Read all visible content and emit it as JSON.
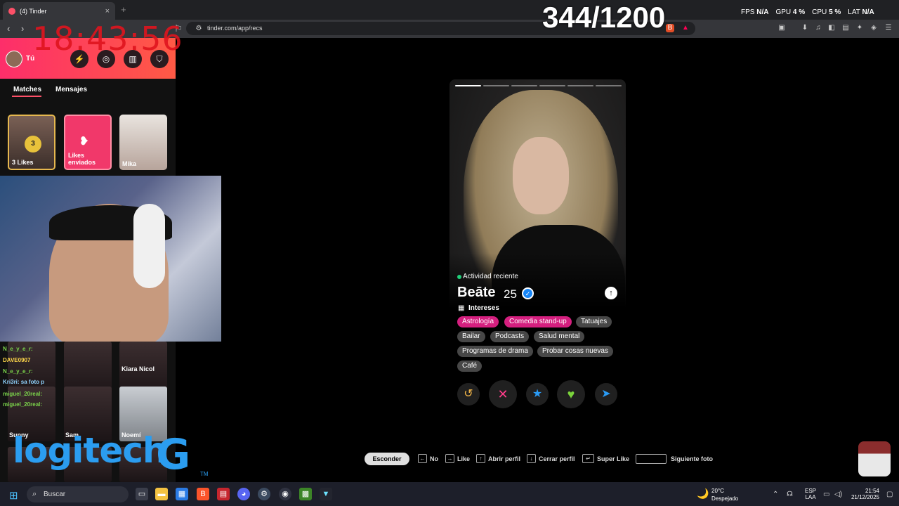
{
  "browser": {
    "tab_title": "(4) Tinder",
    "url": "tinder.com/app/recs",
    "new_tab_glyph": "+"
  },
  "overlay": {
    "clock": "18:43:56",
    "counter": "344/1200",
    "stats": [
      {
        "label": "FPS",
        "value": "N/A"
      },
      {
        "label": "GPU",
        "value": "4 %"
      },
      {
        "label": "CPU",
        "value": "5 %"
      },
      {
        "label": "LAT",
        "value": "N/A"
      }
    ],
    "sponsor_logo": "logitech",
    "sponsor_tm": "TM"
  },
  "sidebar": {
    "user_label": "Tú",
    "tabs": [
      "Matches",
      "Mensajes"
    ],
    "likes_count": "3",
    "likes_label": "3 Likes",
    "sent_label": "Likes enviados",
    "match_name": "Mika",
    "messages": [
      {
        "name": "Kiara Nicol"
      },
      {
        "name": "Sunny"
      },
      {
        "name": "Sam"
      },
      {
        "name": "Noemí"
      }
    ],
    "chat": [
      {
        "user": "N_e_y_e_r",
        "text": ":"
      },
      {
        "user": "DAVE0907",
        "text": ""
      },
      {
        "user": "N_e_y_e_r",
        "text": ":"
      },
      {
        "user": "Kri3ri",
        "text": ": sa foto p"
      },
      {
        "user": "miguel_20real",
        "text": ":"
      },
      {
        "user": "miguel_20real",
        "text": ":"
      }
    ]
  },
  "profile": {
    "photo_count": 6,
    "active_photo": 1,
    "activity": "Actividad reciente",
    "name": "Beāte",
    "age": "25",
    "interests_label": "Intereses",
    "interests": [
      {
        "label": "Astrología",
        "shared": true
      },
      {
        "label": "Comedia stand-up",
        "shared": true
      },
      {
        "label": "Tatuajes",
        "shared": false
      },
      {
        "label": "Bailar",
        "shared": false
      },
      {
        "label": "Podcasts",
        "shared": false
      },
      {
        "label": "Salud mental",
        "shared": false
      },
      {
        "label": "Programas de drama",
        "shared": false
      },
      {
        "label": "Probar cosas nuevas",
        "shared": false
      },
      {
        "label": "Café",
        "shared": false
      }
    ],
    "actions": [
      {
        "name": "rewind-button",
        "glyph": "↺",
        "color": "#f5b748"
      },
      {
        "name": "nope-button",
        "glyph": "✕",
        "color": "#ff3d8b"
      },
      {
        "name": "super-like-button",
        "glyph": "★",
        "color": "#2a9bf5"
      },
      {
        "name": "like-button",
        "glyph": "♥",
        "color": "#7ad33b"
      },
      {
        "name": "boost-button",
        "glyph": "➤",
        "color": "#2a9bf5"
      }
    ]
  },
  "shortcuts": {
    "hide_label": "Esconder",
    "items": [
      {
        "key": "←",
        "label": "No"
      },
      {
        "key": "→",
        "label": "Like"
      },
      {
        "key": "↑",
        "label": "Abrir perfil"
      },
      {
        "key": "↓",
        "label": "Cerrar perfil"
      },
      {
        "key": "↵",
        "label": "Super Like"
      },
      {
        "key": "",
        "label": "Siguiente foto"
      }
    ]
  },
  "taskbar": {
    "search_placeholder": "Buscar",
    "weather_temp": "20°C",
    "weather_desc": "Despejado",
    "lang_top": "ESP",
    "lang_bottom": "LAA",
    "time": "21:54",
    "date": "21/12/2025"
  },
  "colors": {
    "brand": "#fd5068",
    "accent_pink": "#d51f7f",
    "verified": "#1786f8"
  }
}
